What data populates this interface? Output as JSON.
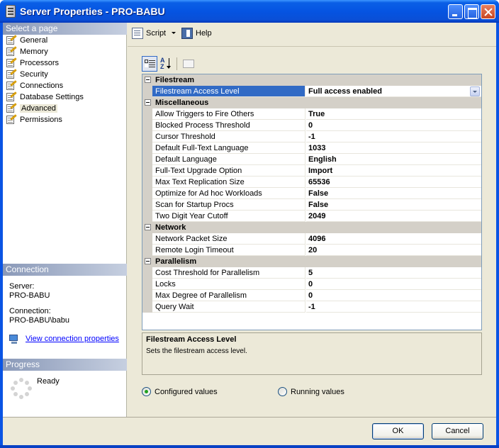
{
  "window": {
    "title": "Server Properties - PRO-BABU"
  },
  "left_panel": {
    "select_page_header": "Select a page",
    "pages": [
      {
        "label": "General"
      },
      {
        "label": "Memory"
      },
      {
        "label": "Processors"
      },
      {
        "label": "Security"
      },
      {
        "label": "Connections"
      },
      {
        "label": "Database Settings"
      },
      {
        "label": "Advanced",
        "selected": true
      },
      {
        "label": "Permissions"
      }
    ],
    "connection_header": "Connection",
    "server_label": "Server:",
    "server_value": "PRO-BABU",
    "connection_label": "Connection:",
    "connection_value": "PRO-BABU\\babu",
    "view_connection_link": "View connection properties",
    "progress_header": "Progress",
    "progress_status": "Ready"
  },
  "toolbar": {
    "script_label": "Script",
    "help_label": "Help"
  },
  "property_grid": {
    "az_label": "A Z",
    "sections": [
      {
        "name": "Filestream",
        "items": [
          {
            "name": "Filestream Access Level",
            "value": "Full access enabled",
            "selected": true,
            "dropdown": true
          }
        ]
      },
      {
        "name": "Miscellaneous",
        "items": [
          {
            "name": "Allow Triggers to Fire Others",
            "value": "True"
          },
          {
            "name": "Blocked Process Threshold",
            "value": "0"
          },
          {
            "name": "Cursor Threshold",
            "value": "-1"
          },
          {
            "name": "Default Full-Text Language",
            "value": "1033"
          },
          {
            "name": "Default Language",
            "value": "English"
          },
          {
            "name": "Full-Text Upgrade Option",
            "value": "Import"
          },
          {
            "name": "Max Text Replication Size",
            "value": "65536"
          },
          {
            "name": "Optimize for Ad hoc Workloads",
            "value": "False"
          },
          {
            "name": "Scan for Startup Procs",
            "value": "False"
          },
          {
            "name": "Two Digit Year Cutoff",
            "value": "2049"
          }
        ]
      },
      {
        "name": "Network",
        "items": [
          {
            "name": "Network Packet Size",
            "value": "4096"
          },
          {
            "name": "Remote Login Timeout",
            "value": "20"
          }
        ]
      },
      {
        "name": "Parallelism",
        "items": [
          {
            "name": "Cost Threshold for Parallelism",
            "value": "5"
          },
          {
            "name": "Locks",
            "value": "0"
          },
          {
            "name": "Max Degree of Parallelism",
            "value": "0"
          },
          {
            "name": "Query Wait",
            "value": "-1"
          }
        ]
      }
    ]
  },
  "description": {
    "title": "Filestream Access Level",
    "text": "Sets the filestream access level."
  },
  "value_mode": {
    "configured_label": "Configured values",
    "running_label": "Running values",
    "selected": "configured"
  },
  "buttons": {
    "ok_label": "OK",
    "cancel_label": "Cancel"
  },
  "colors": {
    "selection": "#316ac5",
    "link": "#0000ff",
    "category_bg": "#d4d0c8"
  }
}
